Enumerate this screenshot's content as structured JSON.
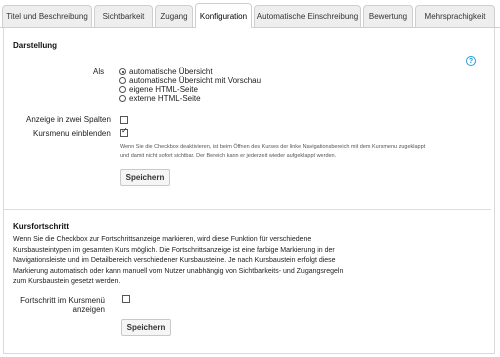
{
  "tabs": [
    {
      "label": "Titel und Beschreibung",
      "active": false
    },
    {
      "label": "Sichtbarkeit",
      "active": false
    },
    {
      "label": "Zugang",
      "active": false
    },
    {
      "label": "Konfiguration",
      "active": true
    },
    {
      "label": "Automatische Einschreibung",
      "active": false
    },
    {
      "label": "Bewertung",
      "active": false
    },
    {
      "label": "Mehrsprachigkeit",
      "active": false
    }
  ],
  "darstellung": {
    "title": "Darstellung",
    "help_symbol": "?",
    "als_label": "Als",
    "options": [
      {
        "label": "automatische Übersicht",
        "checked": true
      },
      {
        "label": "automatische Übersicht mit Vorschau",
        "checked": false
      },
      {
        "label": "eigene HTML-Seite",
        "checked": false
      },
      {
        "label": "externe HTML-Seite",
        "checked": false
      }
    ],
    "two_columns_label": "Anzeige in zwei Spalten",
    "two_columns_checked": false,
    "course_menu_label": "Kursmenu einblenden",
    "course_menu_checked": true,
    "hint_line1": "Wenn Sie die Checkbox deaktivieren, ist beim Öffnen des Kurses der linke Navigationsbereich mit dem Kursmenu zugeklappt",
    "hint_line2": "und damit nicht sofort sichtbar. Der Bereich kann er jederzeit wieder aufgeklappt werden.",
    "save_label": "Speichern"
  },
  "kursfortschritt": {
    "title": "Kursfortschritt",
    "description_lines": [
      "Wenn Sie die Checkbox zur Fortschrittsanzeige markieren, wird diese Funktion für verschiedene",
      "Kursbausteintypen im gesamten Kurs möglich. Die Fortschrittsanzeige ist eine farbige Markierung in der",
      "Navigationsleiste und im Detailbereich verschiedener Kursbausteine. Je nach Kursbaustein erfolgt diese",
      "Markierung automatisch oder kann manuell vom Nutzer unabhängig von Sichtbarkeits- und Zugangsregeln",
      "zum Kursbaustein gesetzt werden."
    ],
    "progress_label_line1": "Fortschritt im Kursmenü",
    "progress_label_line2": "anzeigen",
    "progress_checked": false,
    "save_label": "Speichern"
  }
}
